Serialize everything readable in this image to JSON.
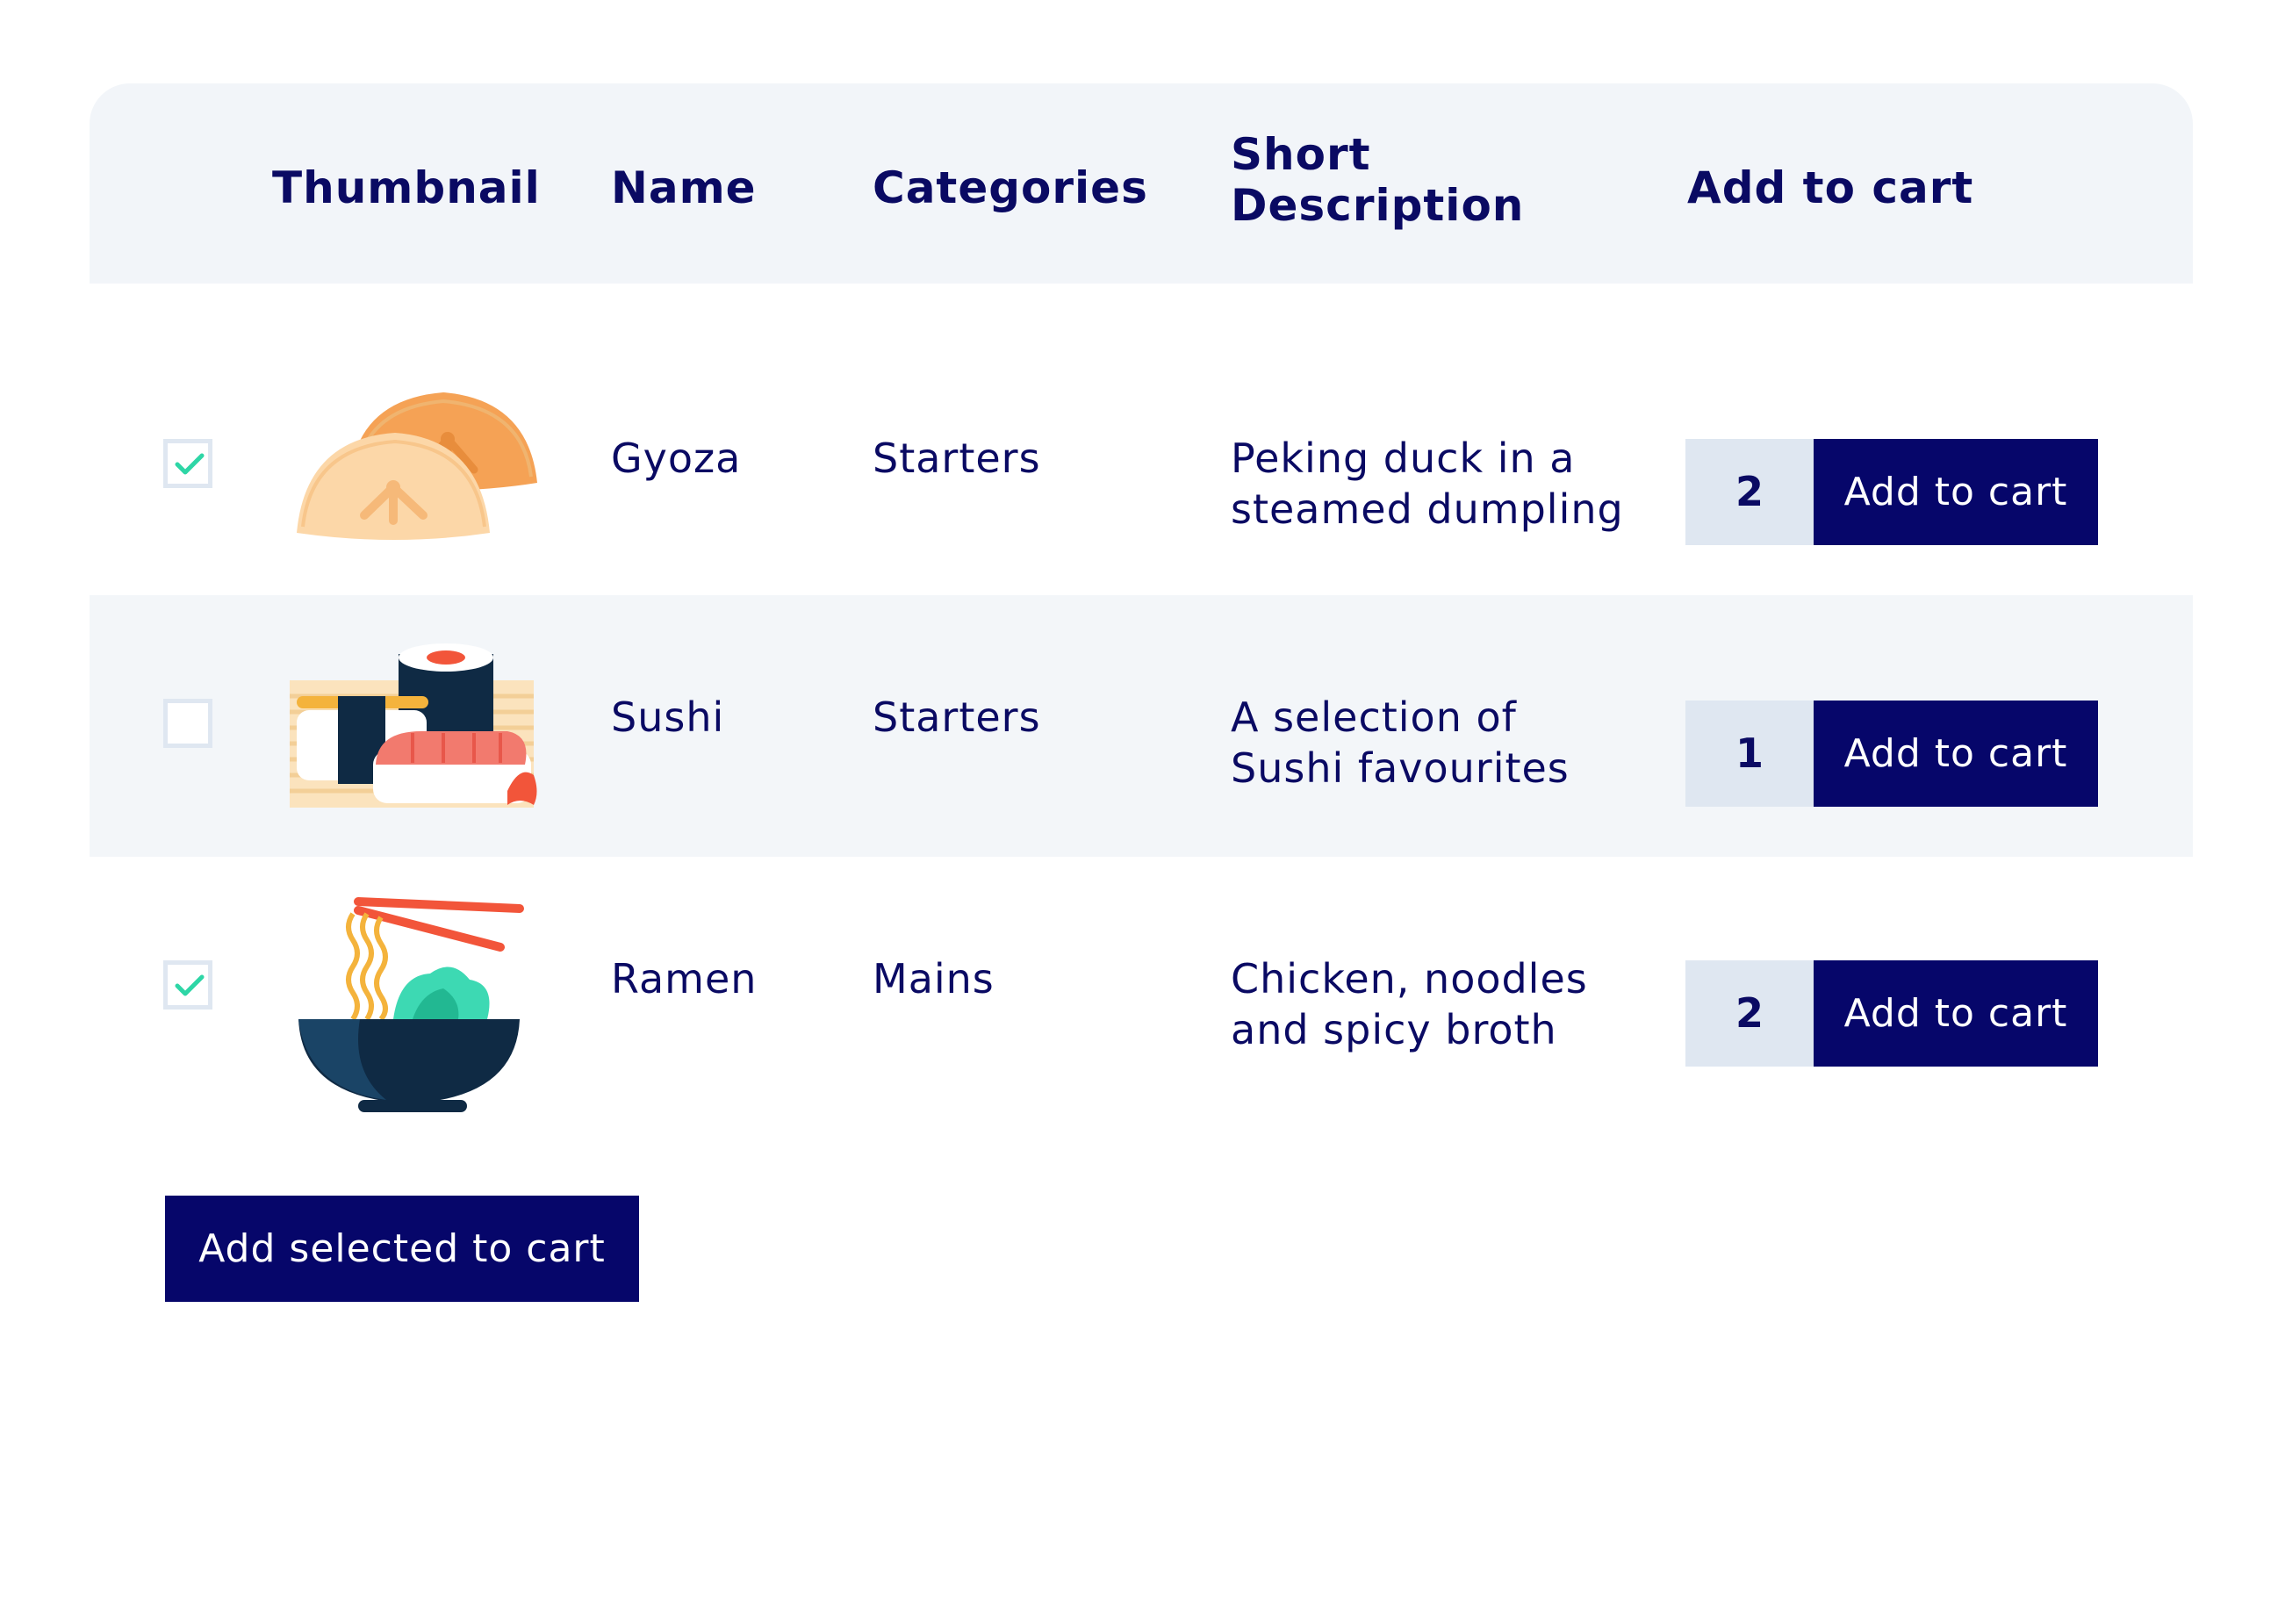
{
  "header": {
    "thumbnail": "Thumbnail",
    "name": "Name",
    "categories": "Categories",
    "short_description_line1": "Short",
    "short_description_line2": "Description",
    "add_to_cart": "Add to cart"
  },
  "rows": [
    {
      "checked": true,
      "thumbnail_icon": "gyoza-icon",
      "name": "Gyoza",
      "category": "Starters",
      "description_line1": "Peking duck in a",
      "description_line2": "steamed dumpling",
      "quantity": "2",
      "button_label": "Add to cart"
    },
    {
      "checked": false,
      "thumbnail_icon": "sushi-icon",
      "name": "Sushi",
      "category": "Starters",
      "description_line1": "A selection of",
      "description_line2": "Sushi favourites",
      "quantity": "1",
      "button_label": "Add to cart"
    },
    {
      "checked": true,
      "thumbnail_icon": "ramen-icon",
      "name": "Ramen",
      "category": "Mains",
      "description_line1": "Chicken, noodles",
      "description_line2": "and spicy broth",
      "quantity": "2",
      "button_label": "Add to cart"
    }
  ],
  "footer": {
    "bulk_button_label": "Add selected to cart"
  },
  "colors": {
    "primary": "#06066a",
    "text": "#0a0a63",
    "header_bg": "#f2f5f9",
    "qty_bg": "#dfe7f1",
    "check": "#2ed6a6"
  }
}
